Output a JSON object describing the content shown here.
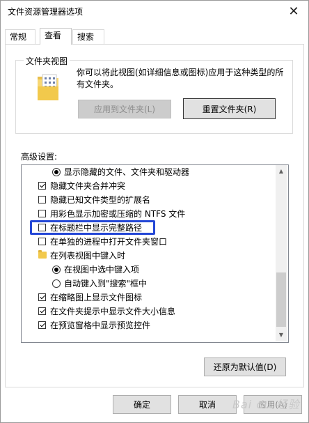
{
  "window": {
    "title": "文件资源管理器选项"
  },
  "tabs": [
    {
      "label": "常规",
      "active": false
    },
    {
      "label": "查看",
      "active": true
    },
    {
      "label": "搜索",
      "active": false
    }
  ],
  "folder_views": {
    "title": "文件夹视图",
    "description": "你可以将此视图(如详细信息或图标)应用于这种类型的所有文件夹。",
    "apply_button": "应用到文件夹(L)",
    "reset_button": "重置文件夹(R)"
  },
  "advanced": {
    "label": "高级设置:",
    "items": [
      {
        "type": "radio",
        "checked": true,
        "indent": 1,
        "label": "显示隐藏的文件、文件夹和驱动器"
      },
      {
        "type": "checkbox",
        "checked": true,
        "indent": 0,
        "label": "隐藏文件夹合并冲突"
      },
      {
        "type": "checkbox",
        "checked": false,
        "indent": 0,
        "label": "隐藏已知文件类型的扩展名"
      },
      {
        "type": "checkbox",
        "checked": false,
        "indent": 0,
        "label": "用彩色显示加密或压缩的 NTFS 文件"
      },
      {
        "type": "checkbox",
        "checked": false,
        "indent": 0,
        "label": "在标题栏中显示完整路径"
      },
      {
        "type": "checkbox",
        "checked": false,
        "indent": 0,
        "label": "在单独的进程中打开文件夹窗口"
      },
      {
        "type": "folder",
        "checked": false,
        "indent": 0,
        "label": "在列表视图中键入时"
      },
      {
        "type": "radio",
        "checked": true,
        "indent": 1,
        "label": "在视图中选中键入项"
      },
      {
        "type": "radio",
        "checked": false,
        "indent": 1,
        "label": "自动键入到\"搜索\"框中"
      },
      {
        "type": "checkbox",
        "checked": true,
        "indent": 0,
        "label": "在缩略图上显示文件图标"
      },
      {
        "type": "checkbox",
        "checked": true,
        "indent": 0,
        "label": "在文件夹提示中显示文件大小信息"
      },
      {
        "type": "checkbox",
        "checked": true,
        "indent": 0,
        "label": "在预览窗格中显示预览控件"
      }
    ],
    "restore_button": "还原为默认值(D)"
  },
  "footer": {
    "ok_button": "确定",
    "cancel_button": "取消",
    "apply_button": "应用(A)"
  },
  "watermark": "Bai du 经验"
}
